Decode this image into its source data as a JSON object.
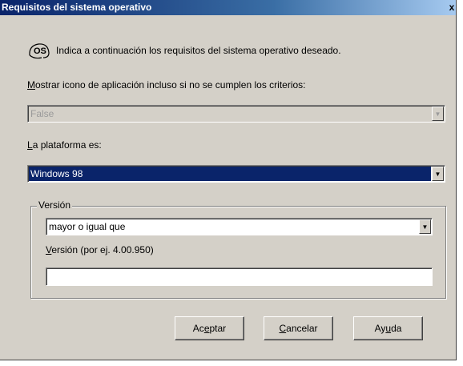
{
  "window": {
    "title": "Requisitos del sistema operativo",
    "close_glyph": "x"
  },
  "intro": {
    "icon": "os-icon",
    "icon_text": "OS",
    "text": "Indica a continuación los requisitos del sistema operativo deseado."
  },
  "show_icon": {
    "label": "Mostrar icono de aplicación incluso si no se cumplen los criterios:",
    "mnemonic": "M",
    "label_rest": "ostrar icono de aplicación incluso si no se cumplen los criterios:",
    "value": "False",
    "enabled": false
  },
  "platform": {
    "label": "La plataforma es:",
    "mnemonic": "L",
    "label_rest": "a plataforma es:",
    "value": "Windows 98"
  },
  "version_group": {
    "title": "Versión",
    "comparison": {
      "value": "mayor o igual que"
    },
    "version_field": {
      "label": "Versión (por ej. 4.00.950)",
      "mnemonic": "V",
      "label_rest": "ersión (por ej. 4.00.950)",
      "value": ""
    }
  },
  "buttons": {
    "accept": {
      "pre": "Ac",
      "mnemonic": "e",
      "post": "ptar",
      "label": "Aceptar"
    },
    "cancel": {
      "pre": "",
      "mnemonic": "C",
      "post": "ancelar",
      "label": "Cancelar"
    },
    "help": {
      "pre": "Ay",
      "mnemonic": "u",
      "post": "da",
      "label": "Ayuda"
    }
  },
  "colors": {
    "face": "#d4d0c8",
    "title_start": "#0a246a",
    "title_end": "#a6caf0",
    "selection": "#0a246a"
  }
}
